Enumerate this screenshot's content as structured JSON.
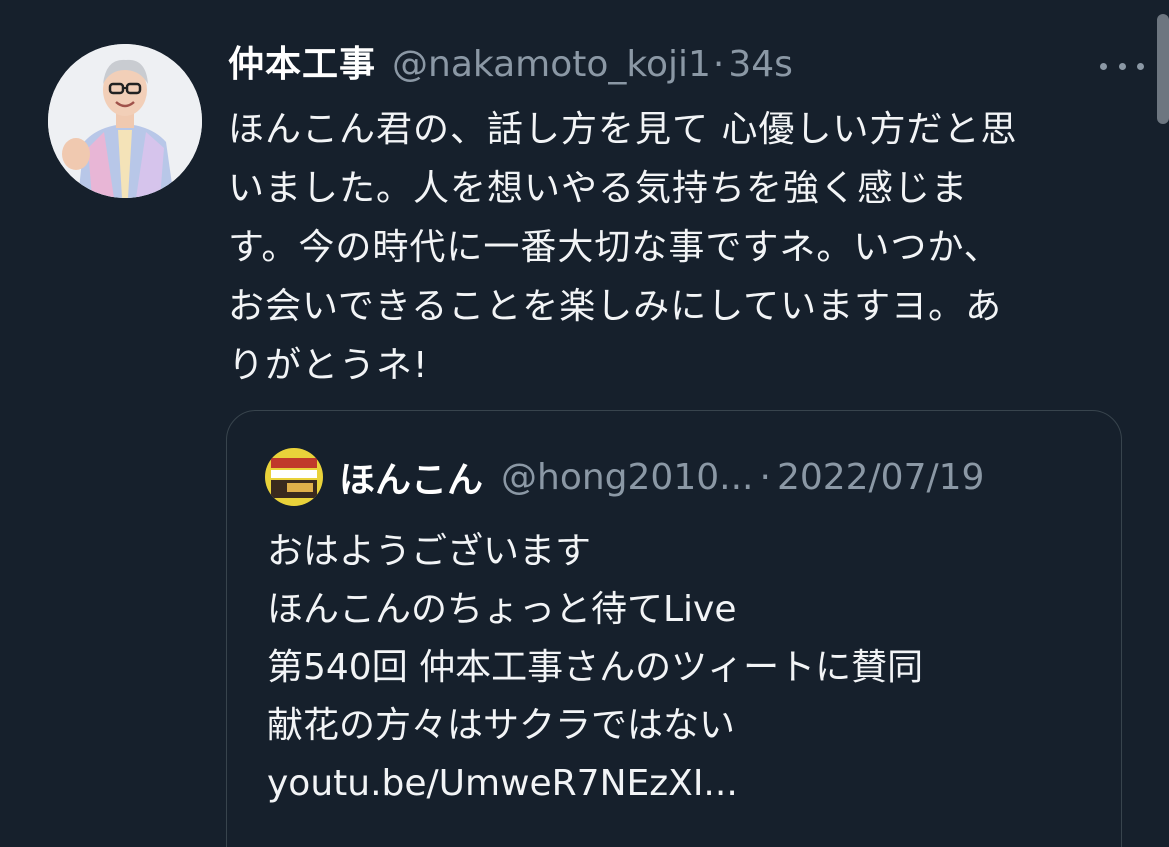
{
  "tweet": {
    "display_name": "仲本工事",
    "handle": "@nakamoto_koji1",
    "separator": "·",
    "time": "34s",
    "more_icon": "more-horizontal-icon",
    "text": "ほんこん君の、話し方を見て 心優しい方だと思\nいました。人を想いやる気持ちを強く感じま\nす。今の時代に一番大切な事ですネ。いつか、\nお会いできることを楽しみにしていますヨ。あ\nりがとうネ!"
  },
  "quote": {
    "display_name": "ほんこん",
    "handle": "@hong2010...",
    "separator": "·",
    "date": "2022/07/19",
    "text": "おはようございます\nほんこんのちょっと待てLive\n第540回 仲本工事さんのツィートに賛同\n献花の方々はサクラではない\nyoutu.be/UmweR7NEzXI..."
  },
  "colors": {
    "background": "#16202c",
    "primary_text": "#f2f4f6",
    "secondary_text": "#8b98a5",
    "border": "#38444d"
  }
}
